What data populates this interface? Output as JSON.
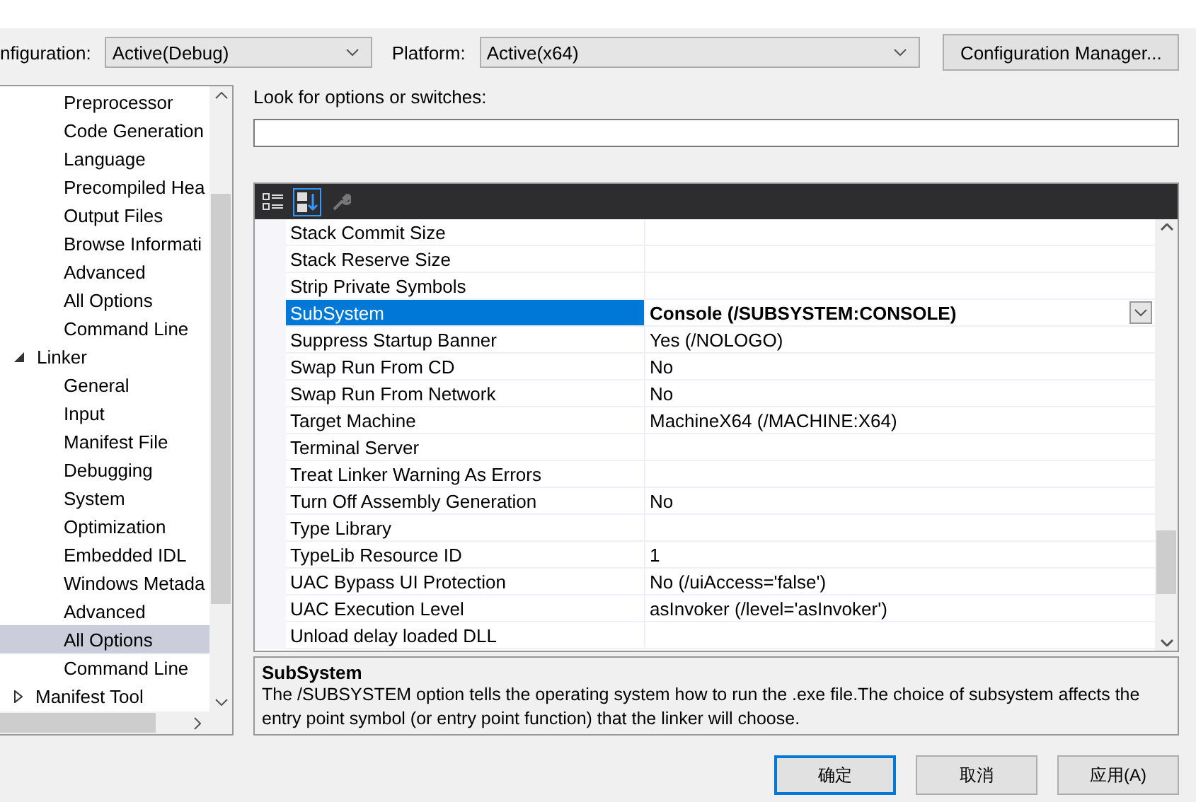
{
  "config_bar": {
    "configuration_label": "nfiguration:",
    "configuration_value": "Active(Debug)",
    "platform_label": "Platform:",
    "platform_value": "Active(x64)",
    "manager_button": "Configuration Manager..."
  },
  "tree": {
    "items": [
      {
        "label": "Preprocessor",
        "kind": "page",
        "selected": false
      },
      {
        "label": "Code Generation",
        "kind": "page",
        "selected": false
      },
      {
        "label": "Language",
        "kind": "page",
        "selected": false
      },
      {
        "label": "Precompiled Hea",
        "kind": "page",
        "selected": false
      },
      {
        "label": "Output Files",
        "kind": "page",
        "selected": false
      },
      {
        "label": "Browse Informati",
        "kind": "page",
        "selected": false
      },
      {
        "label": "Advanced",
        "kind": "page",
        "selected": false
      },
      {
        "label": "All Options",
        "kind": "page",
        "selected": false
      },
      {
        "label": "Command Line",
        "kind": "page",
        "selected": false
      },
      {
        "label": "Linker",
        "kind": "group",
        "expanded": true,
        "selected": false,
        "children": [
          {
            "label": "General",
            "kind": "page",
            "selected": false
          },
          {
            "label": "Input",
            "kind": "page",
            "selected": false
          },
          {
            "label": "Manifest File",
            "kind": "page",
            "selected": false
          },
          {
            "label": "Debugging",
            "kind": "page",
            "selected": false
          },
          {
            "label": "System",
            "kind": "page",
            "selected": false
          },
          {
            "label": "Optimization",
            "kind": "page",
            "selected": false
          },
          {
            "label": "Embedded IDL",
            "kind": "page",
            "selected": false
          },
          {
            "label": "Windows Metada",
            "kind": "page",
            "selected": false
          },
          {
            "label": "Advanced",
            "kind": "page",
            "selected": false
          },
          {
            "label": "All Options",
            "kind": "page",
            "selected": true
          },
          {
            "label": "Command Line",
            "kind": "page",
            "selected": false
          }
        ]
      },
      {
        "label": "Manifest Tool",
        "kind": "group",
        "expanded": false,
        "selected": false
      }
    ]
  },
  "search": {
    "label": "Look for options or switches:"
  },
  "grid": {
    "rows": [
      {
        "name": "Stack Commit Size",
        "value": "",
        "selected": false,
        "modified": false
      },
      {
        "name": "Stack Reserve Size",
        "value": "",
        "selected": false,
        "modified": false
      },
      {
        "name": "Strip Private Symbols",
        "value": "",
        "selected": false,
        "modified": false
      },
      {
        "name": "SubSystem",
        "value": "Console (/SUBSYSTEM:CONSOLE)",
        "selected": true,
        "modified": true
      },
      {
        "name": "Suppress Startup Banner",
        "value": "Yes (/NOLOGO)",
        "selected": false,
        "modified": false
      },
      {
        "name": "Swap Run From CD",
        "value": "No",
        "selected": false,
        "modified": false
      },
      {
        "name": "Swap Run From Network",
        "value": "No",
        "selected": false,
        "modified": false
      },
      {
        "name": "Target Machine",
        "value": "MachineX64 (/MACHINE:X64)",
        "selected": false,
        "modified": false
      },
      {
        "name": "Terminal Server",
        "value": "",
        "selected": false,
        "modified": false
      },
      {
        "name": "Treat Linker Warning As Errors",
        "value": "",
        "selected": false,
        "modified": false
      },
      {
        "name": "Turn Off Assembly Generation",
        "value": "No",
        "selected": false,
        "modified": false
      },
      {
        "name": "Type Library",
        "value": "",
        "selected": false,
        "modified": false
      },
      {
        "name": "TypeLib Resource ID",
        "value": "1",
        "selected": false,
        "modified": false
      },
      {
        "name": "UAC Bypass UI Protection",
        "value": "No (/uiAccess='false')",
        "selected": false,
        "modified": false
      },
      {
        "name": "UAC Execution Level",
        "value": "asInvoker (/level='asInvoker')",
        "selected": false,
        "modified": false
      },
      {
        "name": "Unload delay loaded DLL",
        "value": "",
        "selected": false,
        "modified": false
      }
    ]
  },
  "description": {
    "title": "SubSystem",
    "text": "The /SUBSYSTEM option tells the operating system how to run the .exe file.The choice of subsystem affects the entry point symbol (or entry point function) that the linker will choose."
  },
  "buttons": [
    {
      "label": "确定",
      "default": true
    },
    {
      "label": "取消",
      "default": false
    },
    {
      "label": "应用(A)",
      "default": false
    }
  ]
}
